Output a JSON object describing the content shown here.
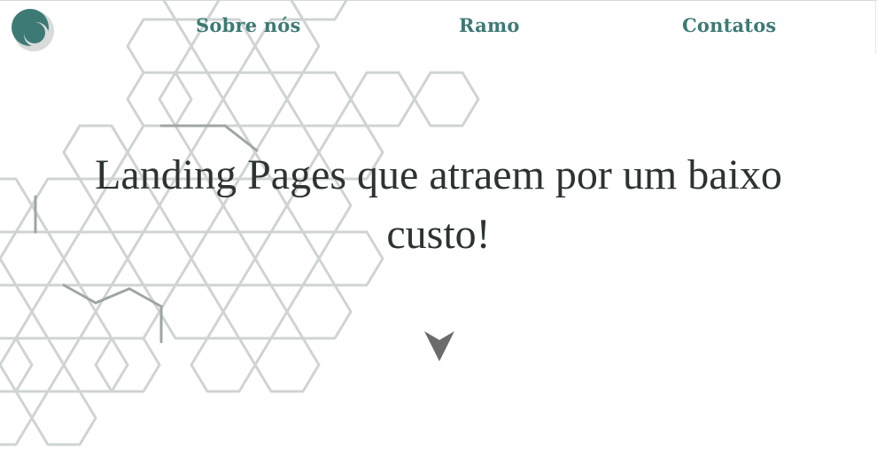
{
  "header": {
    "logo_icon": "crescent-logo-icon",
    "nav": [
      {
        "label": "Sobre nós"
      },
      {
        "label": "Ramo"
      },
      {
        "label": "Contatos"
      }
    ]
  },
  "hero": {
    "title": "Landing Pages que atraem por um baixo custo!",
    "scroll_icon": "chevron-down-icon"
  },
  "colors": {
    "accent": "#3e7a75",
    "title_text": "#2c3332",
    "hex_stroke": "#cfd4d3",
    "hex_stroke_dark": "#9ea5a4",
    "arrow": "#6b6b6b",
    "background": "#ffffff"
  }
}
